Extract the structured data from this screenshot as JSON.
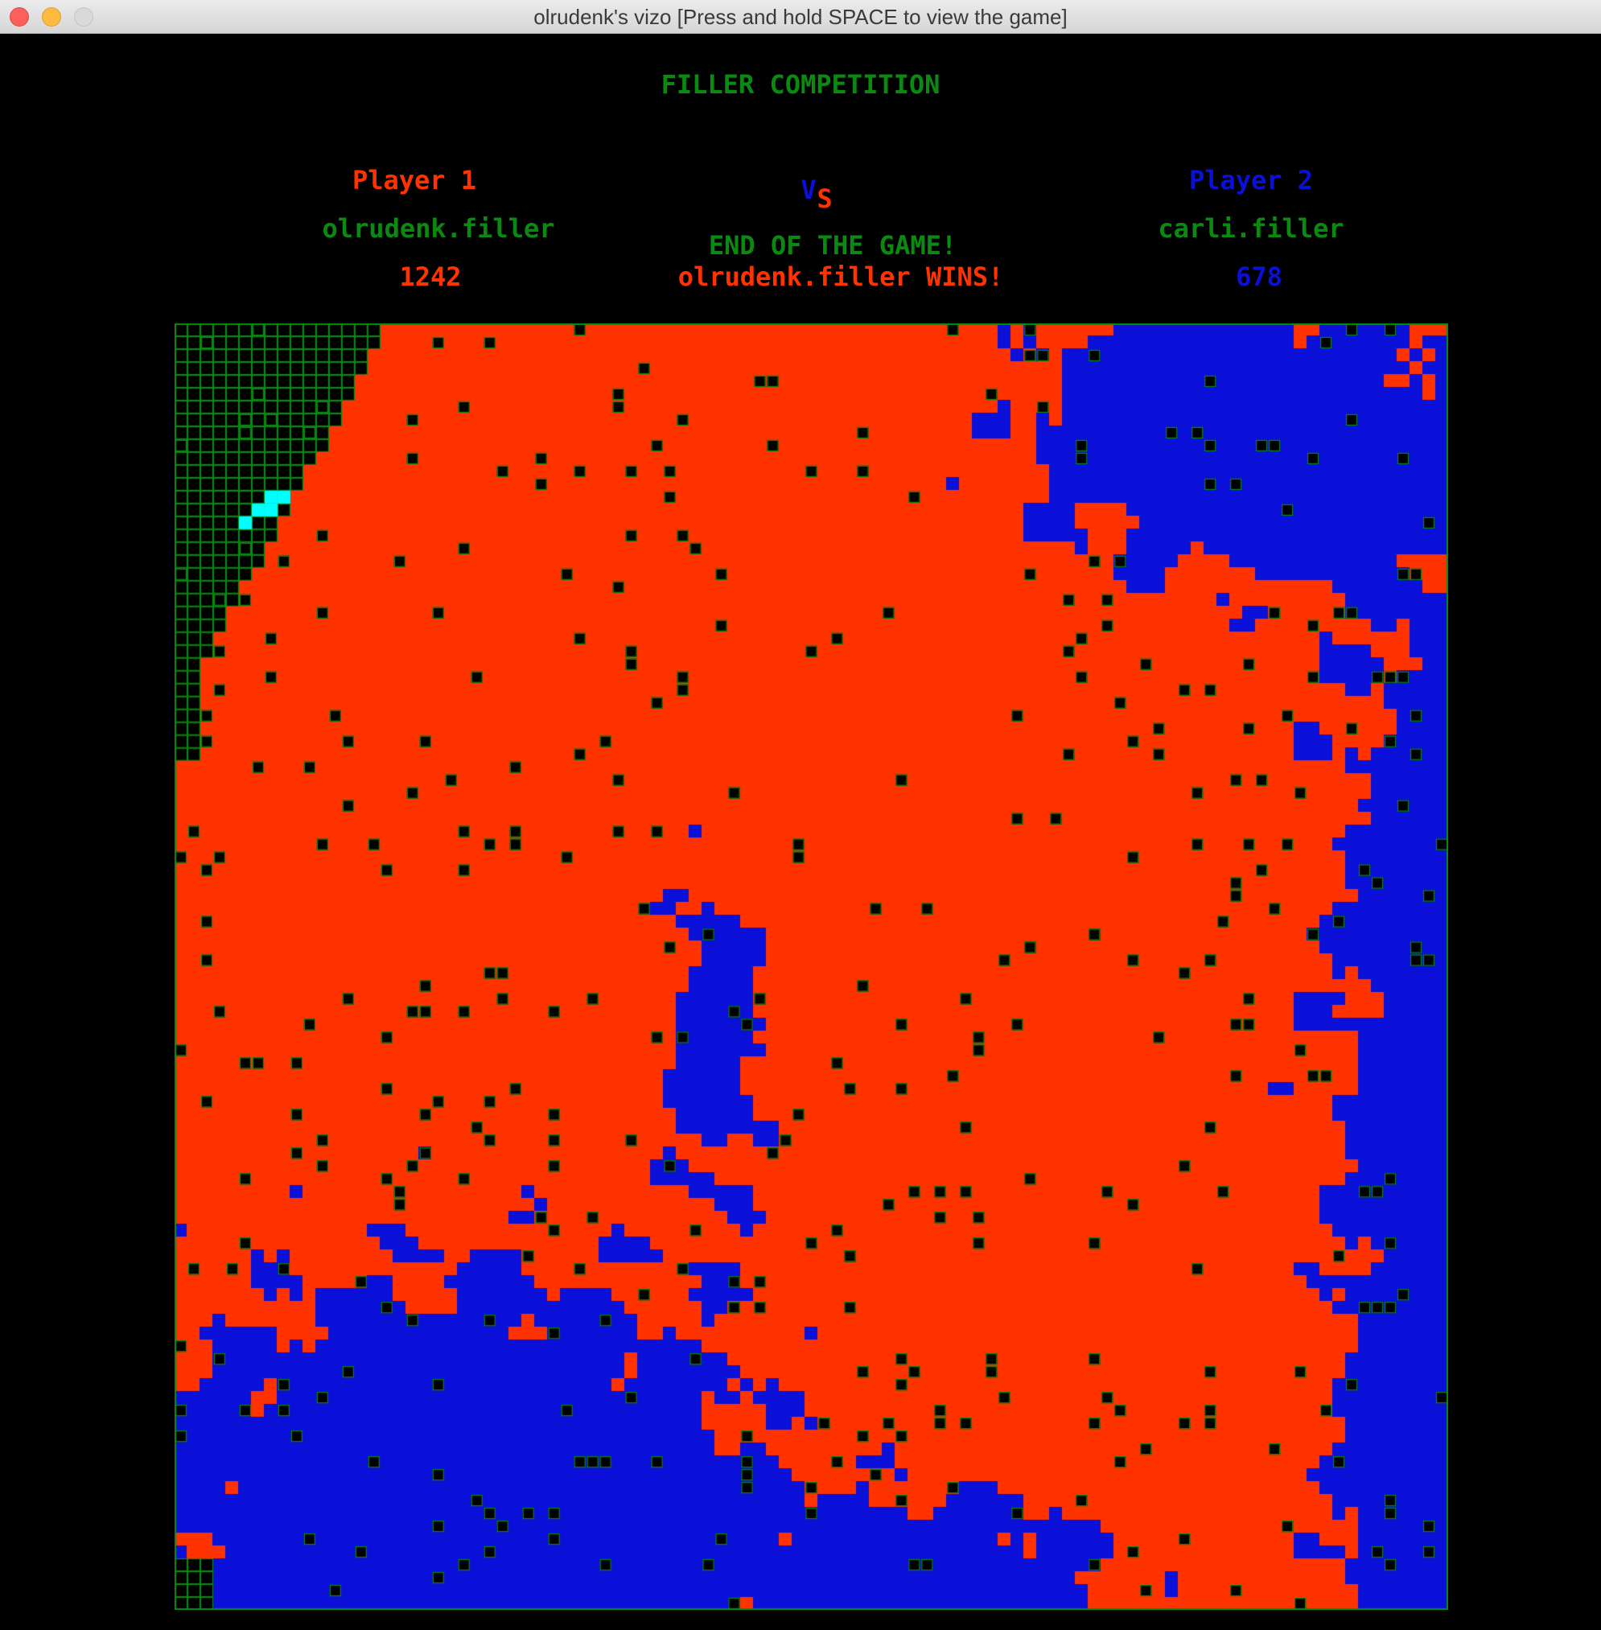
{
  "window": {
    "title": "olrudenk's vizo [Press and hold SPACE to view the game]"
  },
  "header": {
    "title": "FILLER COMPETITION"
  },
  "player1": {
    "label": "Player 1",
    "name": "olrudenk.filler",
    "score": "1242"
  },
  "player2": {
    "label": "Player 2",
    "name": "carli.filler",
    "score": "678"
  },
  "versus": {
    "v": "V",
    "s": "S"
  },
  "status": {
    "line1": "END OF THE GAME!",
    "line2": "olrudenk.filler WINS!"
  },
  "colors": {
    "player1": "#ff3300",
    "player2": "#0a10d8",
    "empty_cell": "#000000",
    "grid_line": "#0b8a12",
    "last_piece": "#00ffff",
    "text_green": "#0b8a12"
  },
  "board": {
    "columns": 99,
    "rows": 100
  }
}
